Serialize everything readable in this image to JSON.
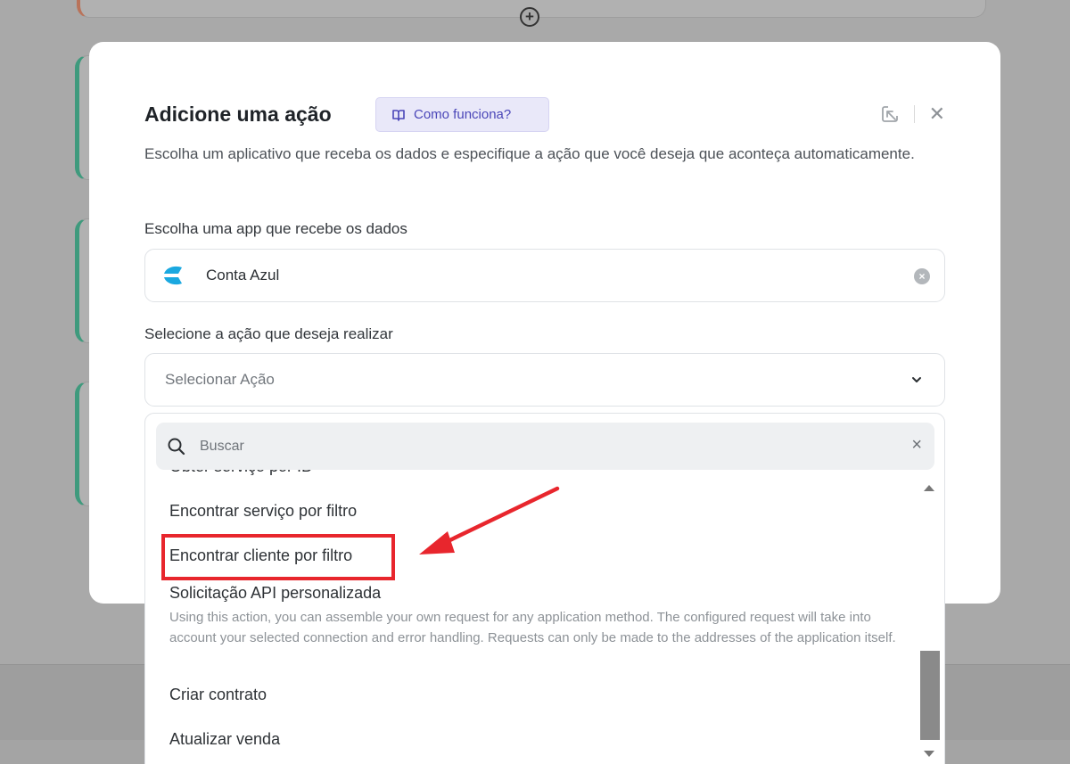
{
  "modal": {
    "title": "Adicione uma ação",
    "how_it_works": "Como funciona?",
    "description": "Escolha um aplicativo que receba os dados e especifique a ação que você deseja que aconteça automaticamente.",
    "app_label": "Escolha uma app que recebe os dados",
    "app_value": "Conta Azul",
    "action_label": "Selecione a ação que deseja realizar",
    "action_placeholder": "Selecionar Ação"
  },
  "dropdown": {
    "search_placeholder": "Buscar",
    "items": [
      {
        "label": "Obter serviço por ID"
      },
      {
        "label": "Encontrar serviço por filtro"
      },
      {
        "label": "Encontrar cliente por filtro",
        "highlighted": true
      },
      {
        "label": "Solicitação API personalizada",
        "description": "Using this action, you can assemble your own request for any application method. The configured request will take into account your selected connection and error handling. Requests can only be made to the addresses of the application itself."
      },
      {
        "label": "Criar contrato"
      },
      {
        "label": "Atualizar venda"
      }
    ]
  },
  "colors": {
    "accent": "#4a46b8",
    "annotation": "#e8262d",
    "app_logo": "#1aa8e0"
  },
  "icons": [
    "book-icon",
    "open-external-icon",
    "close-icon",
    "conta-azul-logo",
    "clear-icon",
    "chevron-down-icon",
    "search-icon",
    "plus-circle-icon"
  ]
}
